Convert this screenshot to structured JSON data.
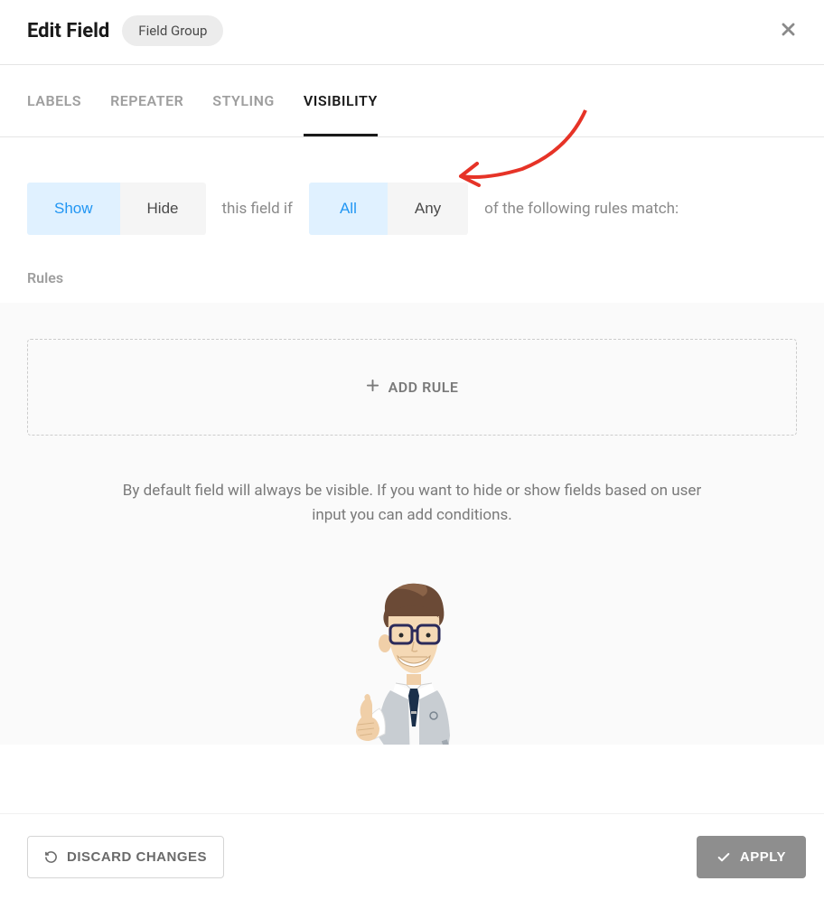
{
  "header": {
    "title": "Edit Field",
    "badge": "Field Group"
  },
  "tabs": [
    {
      "label": "LABELS",
      "active": false
    },
    {
      "label": "REPEATER",
      "active": false
    },
    {
      "label": "STYLING",
      "active": false
    },
    {
      "label": "VISIBILITY",
      "active": true
    }
  ],
  "condition": {
    "showHide": {
      "options": [
        {
          "label": "Show",
          "selected": true
        },
        {
          "label": "Hide",
          "selected": false
        }
      ]
    },
    "text1": "this field if",
    "allAny": {
      "options": [
        {
          "label": "All",
          "selected": true
        },
        {
          "label": "Any",
          "selected": false
        }
      ]
    },
    "text2": "of the following rules match:"
  },
  "rules": {
    "label": "Rules",
    "addRuleLabel": "ADD RULE",
    "helpText": "By default field will always be visible. If you want to hide or show fields based on user input you can add conditions."
  },
  "footer": {
    "discard": "DISCARD CHANGES",
    "apply": "APPLY"
  }
}
